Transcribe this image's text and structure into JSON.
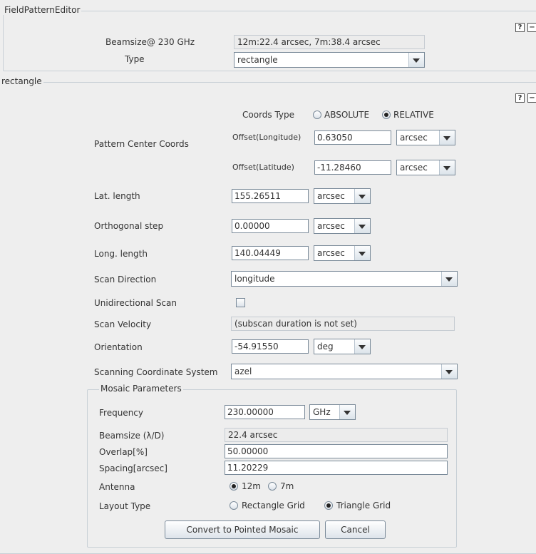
{
  "top_panel": {
    "title": "FieldPatternEditor",
    "help_label": "?",
    "collapse_label": "−",
    "beamsize_label": "Beamsize@ 230 GHz",
    "beamsize_value": "12m:22.4 arcsec, 7m:38.4 arcsec",
    "type_label": "Type",
    "type_value": "rectangle"
  },
  "rect_panel": {
    "title": "rectangle",
    "help_label": "?",
    "collapse_label": "−",
    "coords_type_label": "Coords Type",
    "coords_options": [
      {
        "label": "ABSOLUTE",
        "selected": false
      },
      {
        "label": "RELATIVE",
        "selected": true
      }
    ],
    "pattern_center_label": "Pattern Center Coords",
    "offset_lon_label": "Offset(Longitude)",
    "offset_lon_value": "0.63050",
    "offset_lon_unit": "arcsec",
    "offset_lat_label": "Offset(Latitude)",
    "offset_lat_value": "-11.28460",
    "offset_lat_unit": "arcsec",
    "lat_length_label": "Lat. length",
    "lat_length_value": "155.26511",
    "lat_length_unit": "arcsec",
    "orth_step_label": "Orthogonal step",
    "orth_step_value": "0.00000",
    "orth_step_unit": "arcsec",
    "long_length_label": "Long. length",
    "long_length_value": "140.04449",
    "long_length_unit": "arcsec",
    "scan_direction_label": "Scan Direction",
    "scan_direction_value": "longitude",
    "unidirectional_label": "Unidirectional Scan",
    "unidirectional_checked": false,
    "scan_velocity_label": "Scan Velocity",
    "scan_velocity_value": "(subscan duration is not set)",
    "orientation_label": "Orientation",
    "orientation_value": "-54.91550",
    "orientation_unit": "deg",
    "scan_coord_label": "Scanning Coordinate System",
    "scan_coord_value": "azel"
  },
  "mosaic": {
    "title": "Mosaic Parameters",
    "frequency_label": "Frequency",
    "frequency_value": "230.00000",
    "frequency_unit": "GHz",
    "beamsize_label": "Beamsize (λ/D)",
    "beamsize_value": "22.4 arcsec",
    "overlap_label": "Overlap[%]",
    "overlap_value": "50.00000",
    "spacing_label": "Spacing[arcsec]",
    "spacing_value": "11.20229",
    "antenna_label": "Antenna",
    "antenna_options": [
      {
        "label": "12m",
        "selected": true
      },
      {
        "label": "7m",
        "selected": false
      }
    ],
    "layout_label": "Layout Type",
    "layout_options": [
      {
        "label": "Rectangle Grid",
        "selected": false
      },
      {
        "label": "Triangle Grid",
        "selected": true
      }
    ],
    "convert_button": "Convert to Pointed Mosaic",
    "cancel_button": "Cancel"
  }
}
